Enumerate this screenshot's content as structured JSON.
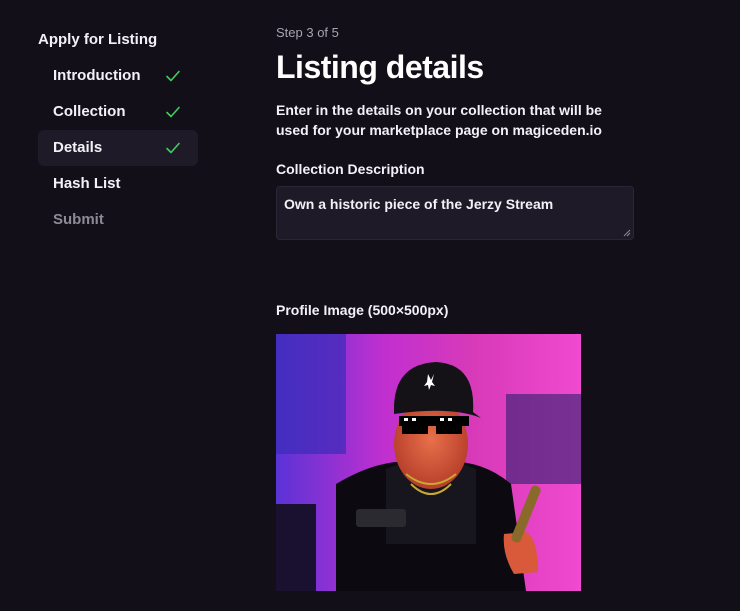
{
  "sidebar": {
    "title": "Apply for Listing",
    "items": [
      {
        "label": "Introduction",
        "completed": true
      },
      {
        "label": "Collection",
        "completed": true
      },
      {
        "label": "Details",
        "completed": true,
        "active": true
      },
      {
        "label": "Hash List",
        "completed": false
      },
      {
        "label": "Submit",
        "completed": false,
        "disabled": true
      }
    ]
  },
  "main": {
    "step_counter": "Step 3 of 5",
    "title": "Listing details",
    "description": "Enter in the details on your collection that will be used for your marketplace page on magiceden.io",
    "collection_description": {
      "label": "Collection Description",
      "value": "Own a historic piece of the Jerzy Stream"
    },
    "profile_image": {
      "label": "Profile Image (500×500px)"
    }
  },
  "colors": {
    "background": "#130f19",
    "active_item": "#1f1a28",
    "check": "#3ecf5a",
    "input_bg": "#1e1a28"
  }
}
